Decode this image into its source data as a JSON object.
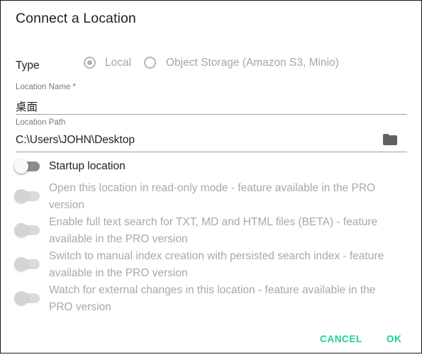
{
  "dialog": {
    "title": "Connect a Location"
  },
  "type": {
    "label": "Type",
    "options": [
      {
        "label": "Local",
        "selected": true
      },
      {
        "label": "Object Storage (Amazon S3, Minio)",
        "selected": false
      }
    ]
  },
  "location_name": {
    "label": "Location Name *",
    "value": "桌面"
  },
  "location_path": {
    "label": "Location Path",
    "value": "C:\\Users\\JOHN\\Desktop",
    "icon": "folder-icon"
  },
  "toggles": [
    {
      "label": "Startup location",
      "enabled": true,
      "on": false
    },
    {
      "label": "Open this location in read-only mode - feature available in the PRO version",
      "enabled": false,
      "on": false
    },
    {
      "label": "Enable full text search for TXT, MD and HTML files (BETA) - feature available in the PRO version",
      "enabled": false,
      "on": false
    },
    {
      "label": "Switch to manual index creation with persisted search index - feature available in the PRO version",
      "enabled": false,
      "on": false
    },
    {
      "label": "Watch for external changes in this location - feature available in the PRO version",
      "enabled": false,
      "on": false
    }
  ],
  "actions": {
    "cancel_label": "CANCEL",
    "ok_label": "OK"
  },
  "colors": {
    "accent": "#1dd19f",
    "disabled_text": "#a8a8a8"
  }
}
